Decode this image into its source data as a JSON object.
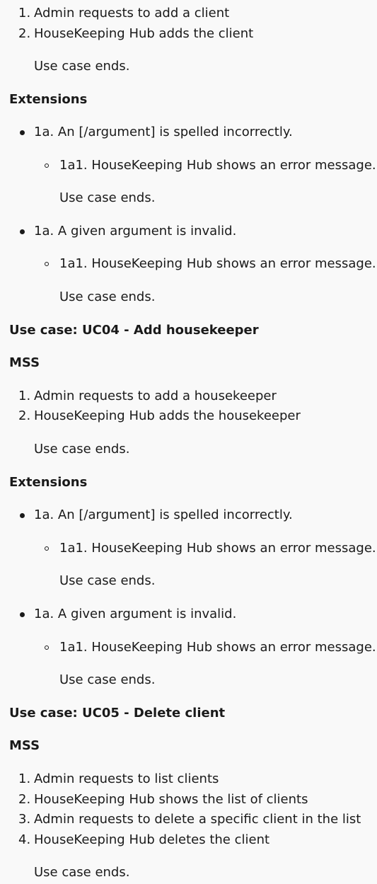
{
  "uc03": {
    "mss_steps": [
      {
        "num": "1.",
        "text": "Admin requests to add a client"
      },
      {
        "num": "2.",
        "text": "HouseKeeping Hub adds the client"
      }
    ],
    "ends": "Use case ends.",
    "extensions_heading": "Extensions",
    "extensions": [
      {
        "label": "1a. An [/argument] is spelled incorrectly.",
        "sub": "1a1. HouseKeeping Hub shows an error message.",
        "ends": "Use case ends."
      },
      {
        "label": "1a. A given argument is invalid.",
        "sub": "1a1. HouseKeeping Hub shows an error message.",
        "ends": "Use case ends."
      }
    ]
  },
  "uc04": {
    "title": "Use case: UC04 - Add housekeeper",
    "mss_heading": "MSS",
    "mss_steps": [
      {
        "num": "1.",
        "text": "Admin requests to add a housekeeper"
      },
      {
        "num": "2.",
        "text": "HouseKeeping Hub adds the housekeeper"
      }
    ],
    "ends": "Use case ends.",
    "extensions_heading": "Extensions",
    "extensions": [
      {
        "label": "1a. An [/argument] is spelled incorrectly.",
        "sub": "1a1. HouseKeeping Hub shows an error message.",
        "ends": "Use case ends."
      },
      {
        "label": "1a. A given argument is invalid.",
        "sub": "1a1. HouseKeeping Hub shows an error message.",
        "ends": "Use case ends."
      }
    ]
  },
  "uc05": {
    "title": "Use case: UC05 - Delete client",
    "mss_heading": "MSS",
    "mss_steps": [
      {
        "num": "1.",
        "text": "Admin requests to list clients"
      },
      {
        "num": "2.",
        "text": "HouseKeeping Hub shows the list of clients"
      },
      {
        "num": "3.",
        "text": "Admin requests to delete a specific client in the list"
      },
      {
        "num": "4.",
        "text": "HouseKeeping Hub deletes the client"
      }
    ],
    "ends": "Use case ends."
  }
}
